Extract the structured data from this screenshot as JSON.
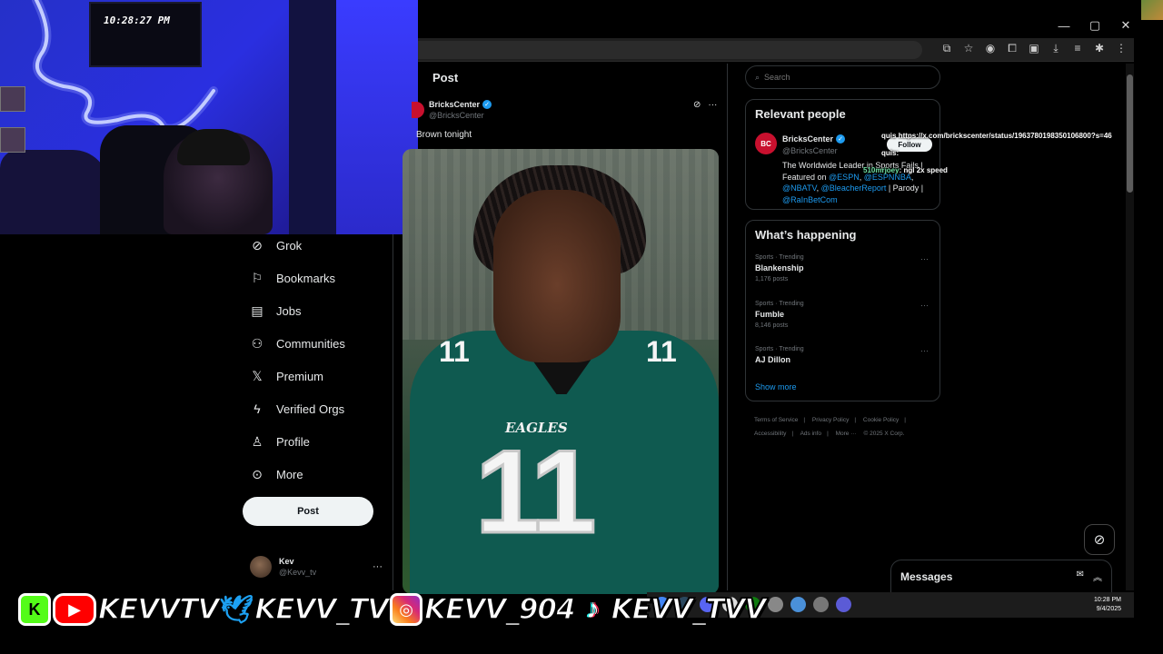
{
  "webcam": {
    "tv_clock": "10:28:27 PM"
  },
  "nav": {
    "items": [
      {
        "label": "Grok",
        "icon": "grok-icon"
      },
      {
        "label": "Bookmarks",
        "icon": "bookmark-icon"
      },
      {
        "label": "Jobs",
        "icon": "briefcase-icon"
      },
      {
        "label": "Communities",
        "icon": "communities-icon"
      },
      {
        "label": "Premium",
        "icon": "x-logo-icon"
      },
      {
        "label": "Verified Orgs",
        "icon": "lightning-icon"
      },
      {
        "label": "Profile",
        "icon": "person-icon"
      },
      {
        "label": "More",
        "icon": "more-circle-icon"
      }
    ],
    "post_button": "Post"
  },
  "account": {
    "name": "Kev",
    "handle": "@Kevv_tv",
    "more": "···"
  },
  "post": {
    "header": "Post",
    "author_name": "BricksCenter",
    "author_handle": "@BricksCenter",
    "text": "Brown tonight",
    "actions_more": "···"
  },
  "search": {
    "placeholder": "Search"
  },
  "relevant_people": {
    "title": "Relevant people",
    "avatar_text": "BC",
    "name": "BricksCenter",
    "handle": "@BricksCenter",
    "follow": "Follow",
    "bio_prefix": "The Worldwide Leader in Sports Fails | Featured on ",
    "mention_1": "@ESPN",
    "sep_1": ", ",
    "mention_2": "@ESPNNBA",
    "sep_2": ", ",
    "mention_3": "@NBATV",
    "sep_3": ", ",
    "mention_4": "@BleacherReport",
    "sep_4": " | Parody | ",
    "mention_5": "@RaInBetCom"
  },
  "whats_happening": {
    "title": "What’s happening",
    "trends": [
      {
        "category": "Sports · Trending",
        "name": "Blankenship",
        "count": "1,176 posts"
      },
      {
        "category": "Sports · Trending",
        "name": "Fumble",
        "count": "8,146 posts"
      },
      {
        "category": "Sports · Trending",
        "name": "AJ Dillon",
        "count": ""
      }
    ],
    "more": "···",
    "show_more": "Show more"
  },
  "footer": {
    "links": [
      "Terms of Service",
      "|",
      "Privacy Policy",
      "|",
      "Cookie Policy",
      "|",
      "Accessibility",
      "|",
      "Ads info",
      "|",
      "More ···",
      "© 2025 X Corp."
    ]
  },
  "chat": {
    "line1_user": "quis",
    "line1_text": "https://x.com/brickscenter/status/1963780198350106800?s=46",
    "line2_user": "quis",
    "line2_text": ":",
    "line3_user": "510mrjoey",
    "line3_text": ": ngl 2x speed"
  },
  "messages": {
    "label": "Messages"
  },
  "taskbar": {
    "time": "10:28 PM",
    "date": "9/4/2025",
    "icon_colors": [
      "#4285f4",
      "#2a475e",
      "#5865f2",
      "#dddddd",
      "#107c10",
      "#888888",
      "#4a90d9",
      "#777777",
      "#5b5bd6"
    ]
  },
  "socials": {
    "kick_letter": "K",
    "youtube": "KEVVTV",
    "twitter": "KEVV_TV",
    "instagram": "KEVV_904",
    "tiktok": "KEVV_TVV"
  },
  "colors": {
    "accent": "#1d9bf0",
    "background": "#000000",
    "kick": "#53fc18",
    "youtube": "#ff0000",
    "twitter": "#1da1f2",
    "instagram": "#d62976"
  }
}
